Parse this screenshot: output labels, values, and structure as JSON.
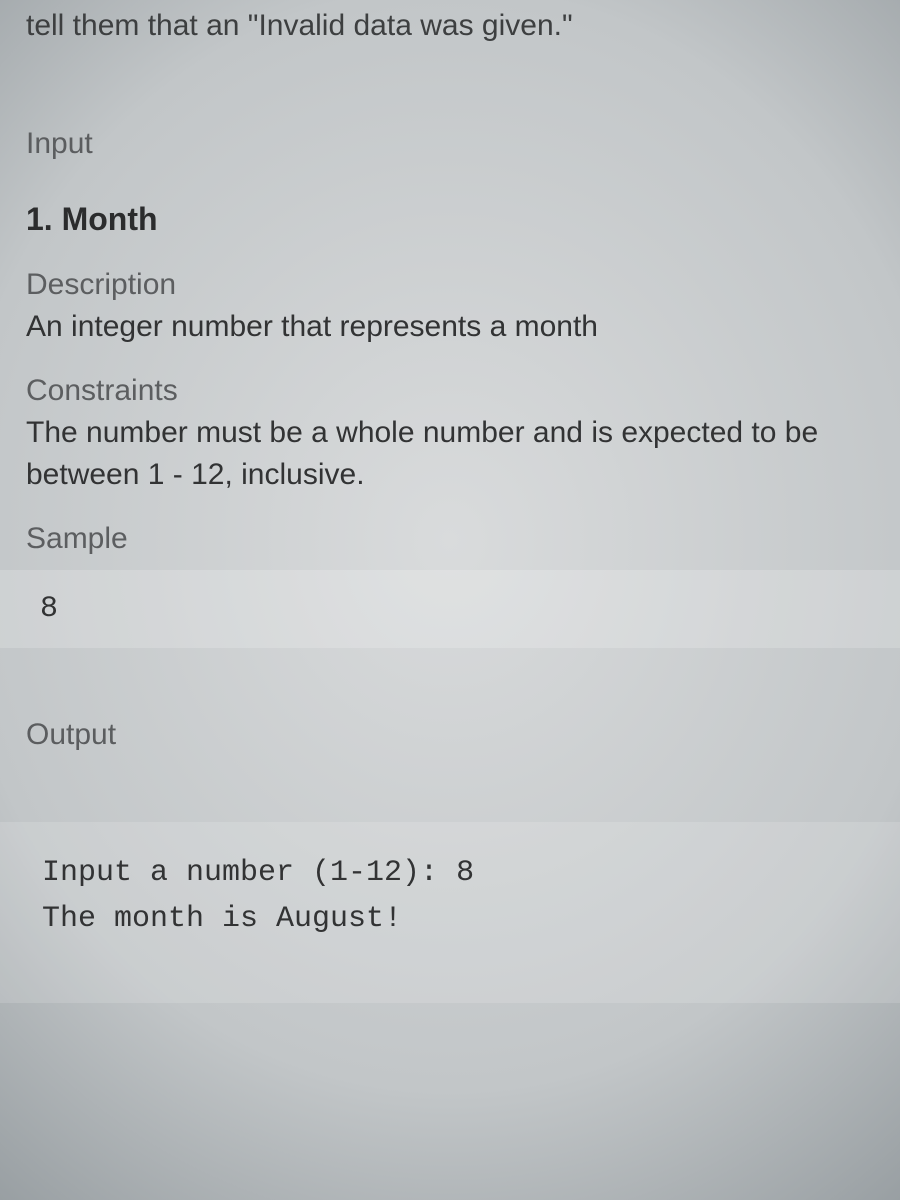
{
  "top_fragment": "tell them that an \"Invalid data was given.\"",
  "input": {
    "heading": "Input",
    "item_number": "1.",
    "item_name": "Month",
    "description_label": "Description",
    "description_text": "An integer number that represents a month",
    "constraints_label": "Constraints",
    "constraints_text": "The number must be a whole number and is expected to be between 1 - 12, inclusive.",
    "sample_label": "Sample",
    "sample_value": "8"
  },
  "output": {
    "heading": "Output",
    "console": "Input a number (1-12): 8\nThe month is August!"
  }
}
